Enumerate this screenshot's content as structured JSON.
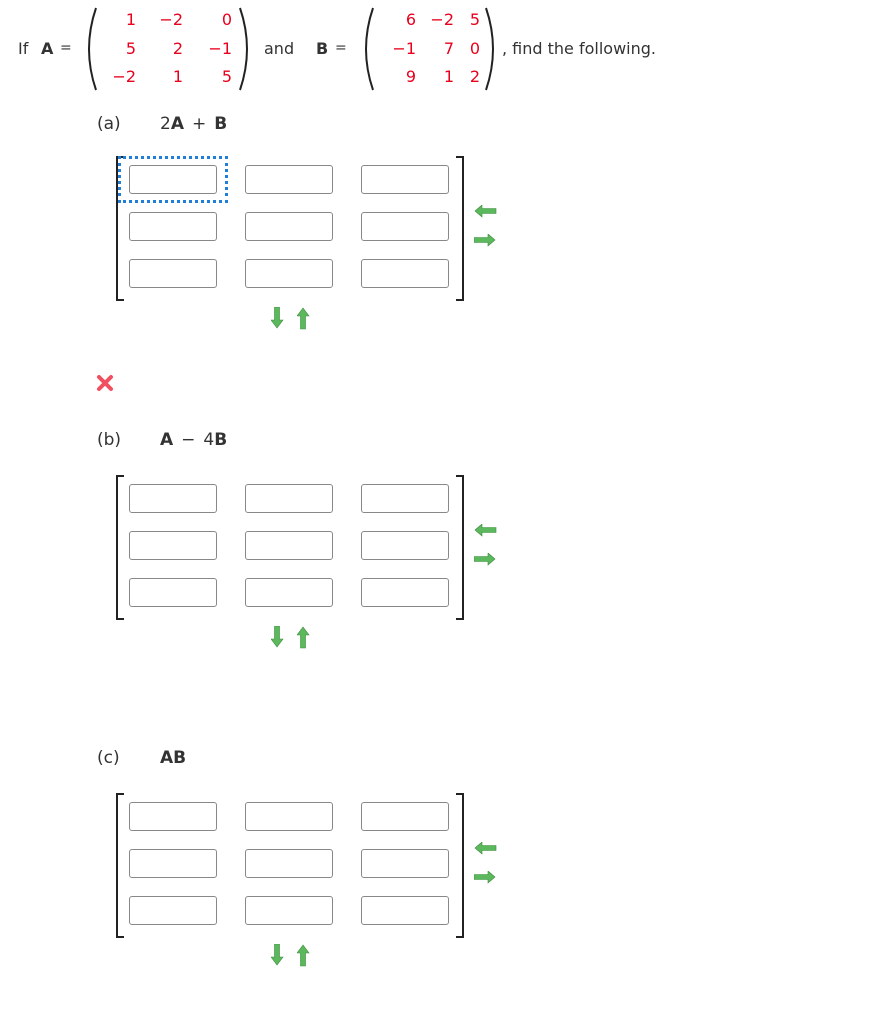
{
  "intro": {
    "prefix": "If",
    "a_label": "A",
    "equals": "=",
    "and_text": "and",
    "b_label": "B",
    "suffix": ", find the following.",
    "matrix_a": [
      [
        "1",
        "−2",
        "0"
      ],
      [
        "5",
        "2",
        "−1"
      ],
      [
        "−2",
        "1",
        "5"
      ]
    ],
    "matrix_b": [
      [
        "6",
        "−2",
        "5"
      ],
      [
        "−1",
        "7",
        "0"
      ],
      [
        "9",
        "1",
        "2"
      ]
    ]
  },
  "parts": [
    {
      "id": "a",
      "label": "(a)",
      "expression": {
        "coef1": "2",
        "m1": "A",
        "op": "+",
        "coef2": "",
        "m2": "B"
      },
      "cells": [
        [
          "",
          "",
          ""
        ],
        [
          "",
          "",
          ""
        ],
        [
          "",
          "",
          ""
        ]
      ],
      "status": "incorrect",
      "focused_cell": [
        0,
        0
      ]
    },
    {
      "id": "b",
      "label": "(b)",
      "expression": {
        "coef1": "",
        "m1": "A",
        "op": "−",
        "coef2": "4",
        "m2": "B"
      },
      "cells": [
        [
          "",
          "",
          ""
        ],
        [
          "",
          "",
          ""
        ],
        [
          "",
          "",
          ""
        ]
      ],
      "status": ""
    },
    {
      "id": "c",
      "label": "(c)",
      "expression": {
        "coef1": "",
        "m1": "AB",
        "op": "",
        "coef2": "",
        "m2": ""
      },
      "cells": [
        [
          "",
          "",
          ""
        ],
        [
          "",
          "",
          ""
        ],
        [
          "",
          "",
          ""
        ]
      ],
      "status": ""
    }
  ],
  "icons": {
    "remove_column": "arrow-left-icon",
    "add_column": "arrow-right-icon",
    "add_row": "arrow-down-icon",
    "remove_row": "arrow-up-icon",
    "incorrect": "x-mark-icon"
  },
  "colors": {
    "given_values": "#e8001c",
    "arrow_green": "#4caf50",
    "incorrect_red": "#f0505f",
    "focus_blue": "#1f7fd8"
  }
}
